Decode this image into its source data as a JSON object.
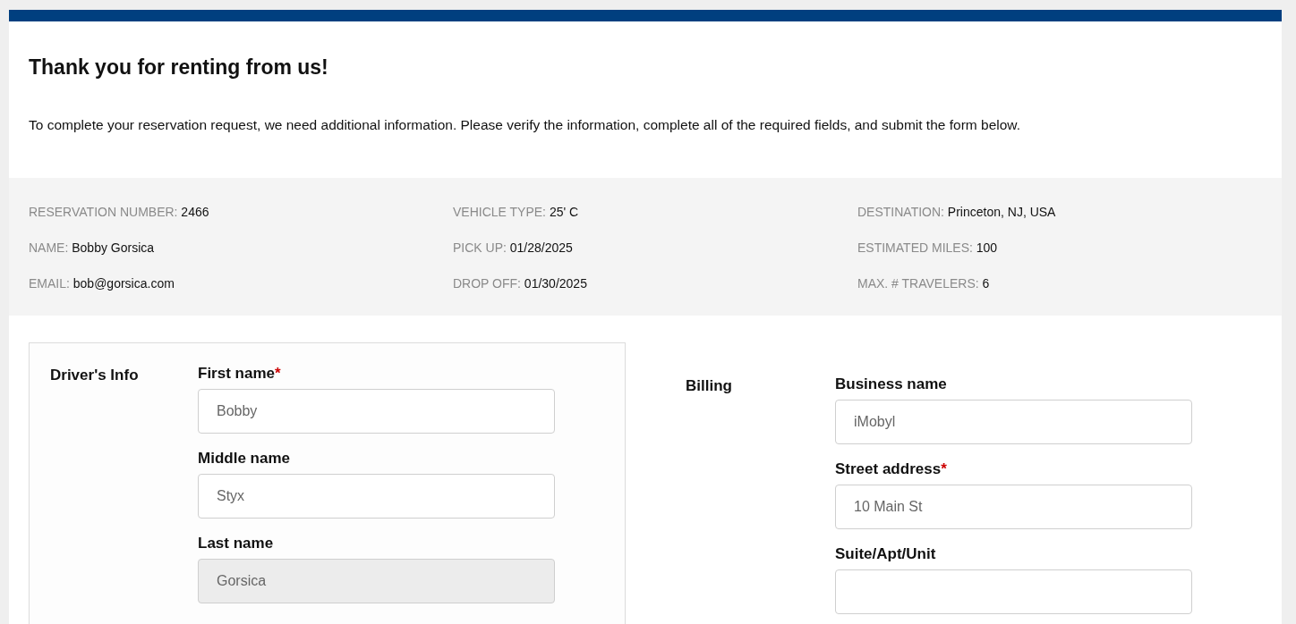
{
  "heading": "Thank you for renting from us!",
  "intro": "To complete your reservation request, we need additional information. Please verify the information, complete all of the required fields, and submit the form below.",
  "summary": [
    [
      {
        "label": "RESERVATION NUMBER:",
        "value": "2466"
      },
      {
        "label": "NAME:",
        "value": "Bobby Gorsica"
      },
      {
        "label": "EMAIL:",
        "value": "bob@gorsica.com"
      }
    ],
    [
      {
        "label": "VEHICLE TYPE:",
        "value": "25' C"
      },
      {
        "label": "PICK UP:",
        "value": "01/28/2025"
      },
      {
        "label": "DROP OFF:",
        "value": "01/30/2025"
      }
    ],
    [
      {
        "label": "DESTINATION:",
        "value": "Princeton, NJ, USA"
      },
      {
        "label": "ESTIMATED MILES:",
        "value": "100"
      },
      {
        "label": "MAX. # TRAVELERS:",
        "value": "6"
      }
    ]
  ],
  "sections": [
    {
      "title": "Driver's Info",
      "boxed": true,
      "fields": [
        {
          "label": "First name",
          "required_mark": "*",
          "disabled": false,
          "value": "Bobby"
        },
        {
          "label": "Middle name",
          "disabled": false,
          "value": "Styx"
        },
        {
          "label": "Last name",
          "disabled": true,
          "value": "Gorsica"
        }
      ]
    },
    {
      "title": "Billing",
      "boxed": false,
      "fields": [
        {
          "label": "Business name",
          "disabled": false,
          "value": "iMobyl"
        },
        {
          "label": "Street address",
          "required_mark": "*",
          "disabled": false,
          "value": "10 Main St"
        },
        {
          "label": "Suite/Apt/Unit",
          "disabled": false
        }
      ]
    }
  ]
}
